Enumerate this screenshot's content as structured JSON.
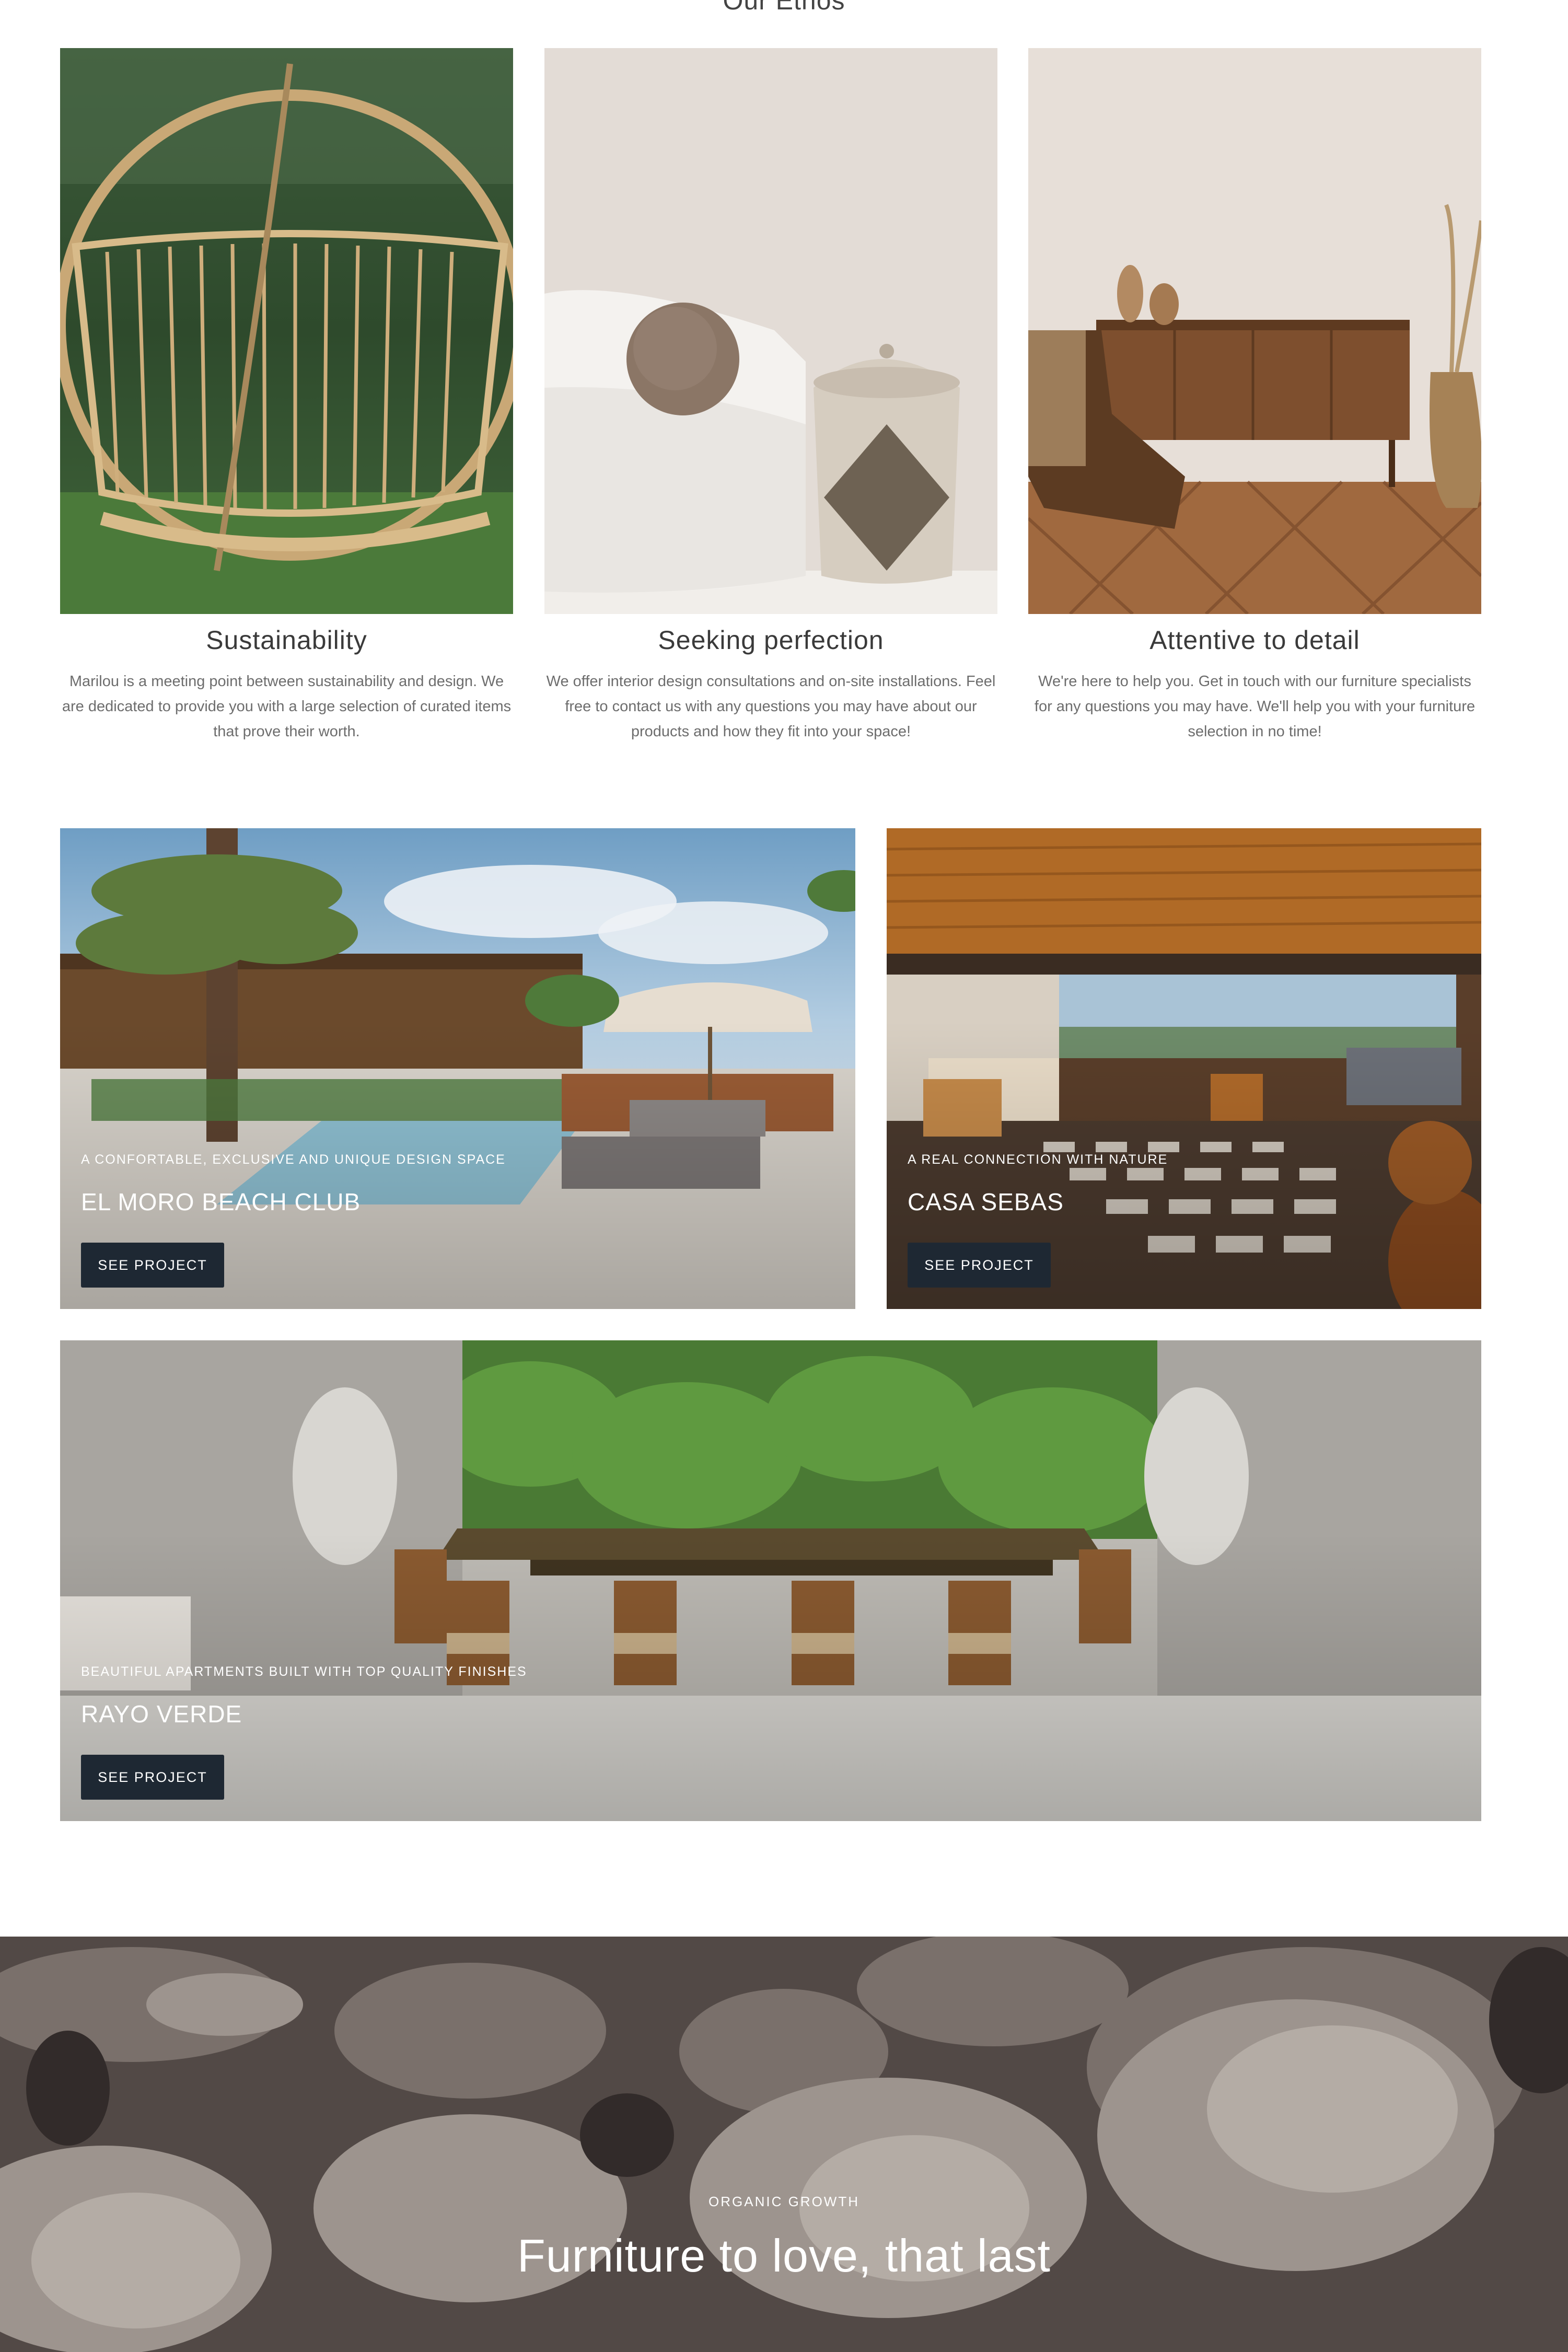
{
  "ethos": {
    "heading": "Our Ethos",
    "items": [
      {
        "title": "Sustainability",
        "text": "Marilou is a meeting point between sustainability and design. We are dedicated to provide you with a large selection of curated items that prove their worth.",
        "image_icon": "hanging-basket-chair-photo"
      },
      {
        "title": "Seeking perfection",
        "text": "We offer interior design consultations and on-site installations. Feel free to contact us with any questions you may have about our products and how they fit into your space!",
        "image_icon": "sofa-and-basket-photo"
      },
      {
        "title": "Attentive to detail",
        "text": "We're here to help you. Get in touch with our furniture specialists for any questions you may have. We'll help you with your furniture selection in no time!",
        "image_icon": "wooden-sideboard-photo"
      }
    ]
  },
  "projects": [
    {
      "subtitle": "A confortable, exclusive and unique design space",
      "title": "EL MORO BEACH CLUB",
      "button": "SEE PROJECT",
      "image_icon": "beach-club-pool-photo"
    },
    {
      "subtitle": "A real connection with nature",
      "title": "CASA SEBAS",
      "button": "SEE PROJECT",
      "image_icon": "open-living-room-photo"
    },
    {
      "subtitle": "Beautiful apartments built with top quality finishes",
      "title": "RAYO VERDE",
      "button": "SEE PROJECT",
      "image_icon": "dining-table-photo"
    }
  ],
  "hero": {
    "subtitle": "ORGANIC GROWTH",
    "title": "Furniture to love, that last",
    "image_icon": "wood-logs-photo"
  },
  "colors": {
    "button_bg": "#1e2833",
    "text_muted": "#6d6d6d"
  }
}
